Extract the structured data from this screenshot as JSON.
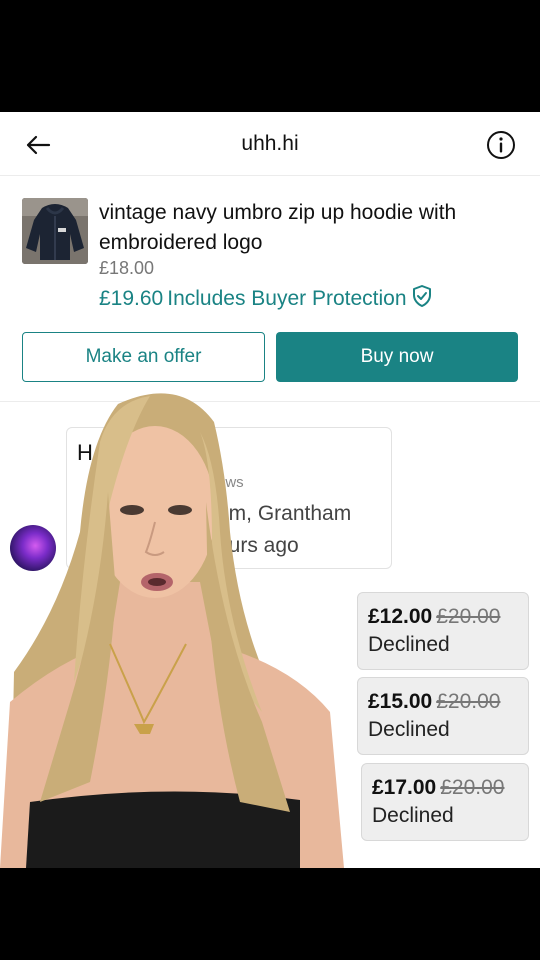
{
  "header": {
    "title": "uhh.hi",
    "back_icon": "back-arrow-icon",
    "info_icon": "info-icon"
  },
  "product": {
    "title": "vintage navy umbro zip up hoodie with embroidered logo",
    "price": "£18.00",
    "price_with_protection": "£19.60",
    "protection_label": "Includes Buyer Protection",
    "shield_icon": "shield-check-icon",
    "offer_button": "Make an offer",
    "buy_button": "Buy now"
  },
  "user_card": {
    "heading_partial": "H",
    "reviews_partial": "ews",
    "location_partial": "om, Grantham",
    "last_seen_partial": "ours ago"
  },
  "offers": [
    {
      "amount": "£12.00",
      "original": "£20.00",
      "status": "Declined"
    },
    {
      "amount": "£15.00",
      "original": "£20.00",
      "status": "Declined"
    },
    {
      "amount": "£17.00",
      "original": "£20.00",
      "status": "Declined"
    }
  ],
  "colors": {
    "accent": "#1a8384",
    "muted": "#777777",
    "bubble": "#eeeeee"
  }
}
